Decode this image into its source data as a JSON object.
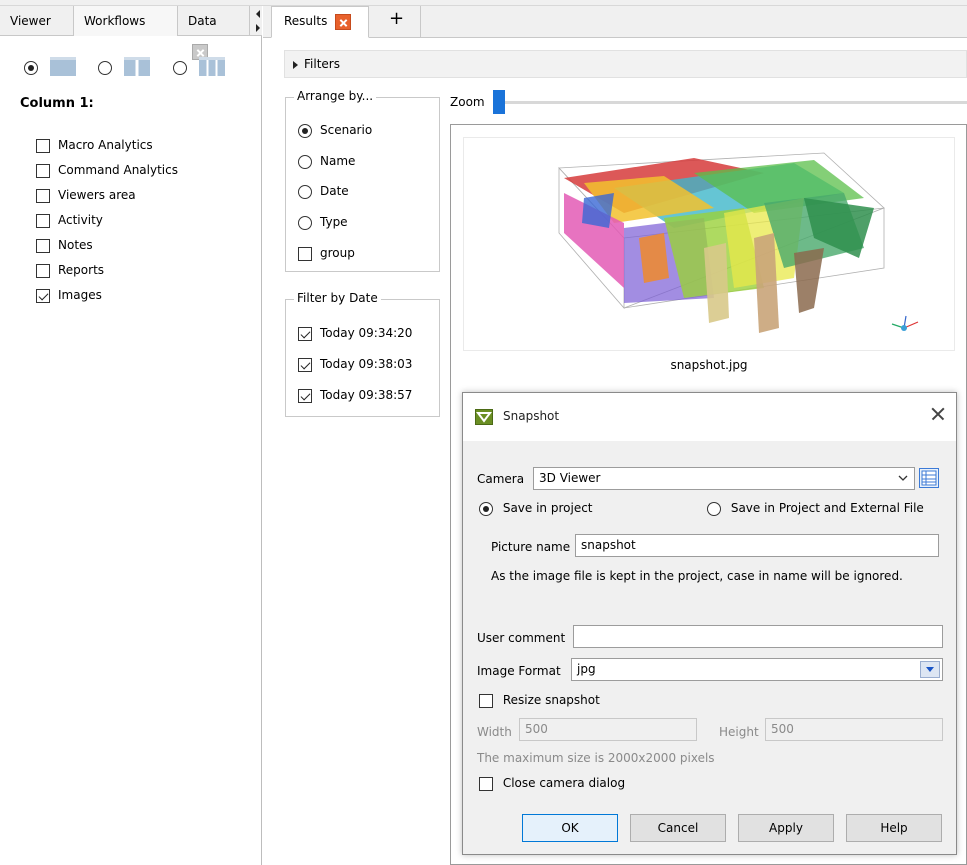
{
  "left_tabs": [
    {
      "label": "Viewer"
    },
    {
      "label": "Workflows"
    },
    {
      "label": "Data"
    }
  ],
  "right_tabs": [
    {
      "label": "Results"
    }
  ],
  "add_tab_label": "+",
  "left_panel": {
    "column_heading": "Column 1:",
    "layout_options_selected": 0,
    "items": [
      {
        "label": "Macro Analytics",
        "checked": false
      },
      {
        "label": "Command Analytics",
        "checked": false
      },
      {
        "label": "Viewers area",
        "checked": false
      },
      {
        "label": "Activity",
        "checked": false
      },
      {
        "label": "Notes",
        "checked": false
      },
      {
        "label": "Reports",
        "checked": false
      },
      {
        "label": "Images",
        "checked": true
      }
    ]
  },
  "filters_label": "Filters",
  "arrange": {
    "title": "Arrange by...",
    "options": [
      {
        "label": "Scenario",
        "selected": true
      },
      {
        "label": "Name",
        "selected": false
      },
      {
        "label": "Date",
        "selected": false
      },
      {
        "label": "Type",
        "selected": false
      }
    ],
    "group_label": "group",
    "group_checked": false
  },
  "filter_by_date": {
    "title": "Filter by Date",
    "items": [
      {
        "label": "Today 09:34:20",
        "checked": true
      },
      {
        "label": "Today 09:38:03",
        "checked": true
      },
      {
        "label": "Today 09:38:57",
        "checked": true
      }
    ]
  },
  "zoom": {
    "label": "Zoom",
    "value": 0
  },
  "thumbnail": {
    "caption": "snapshot.jpg"
  },
  "dialog": {
    "title": "Snapshot",
    "camera_label": "Camera",
    "camera_value": "3D Viewer",
    "save_in_project": "Save in project",
    "save_in_project_external": "Save in Project and External File",
    "save_mode_selected": "project",
    "picture_name_label": "Picture name",
    "picture_name_value": "snapshot",
    "note": "As the image file is kept in the project, case in name will be ignored.",
    "user_comment_label": "User comment",
    "user_comment_value": "",
    "image_format_label": "Image Format",
    "image_format_value": "jpg",
    "resize_label": "Resize snapshot",
    "resize_checked": false,
    "width_label": "Width",
    "width_value": "500",
    "height_label": "Height",
    "height_value": "500",
    "max_size_note": "The maximum size is 2000x2000 pixels",
    "close_camera_label": "Close camera dialog",
    "close_camera_checked": false,
    "buttons": {
      "ok": "OK",
      "cancel": "Cancel",
      "apply": "Apply",
      "help": "Help"
    }
  },
  "colors": {
    "accent": "#1a73d9",
    "tab_close_active": "#e8612c",
    "dialog_logo": "#6a8e23"
  }
}
